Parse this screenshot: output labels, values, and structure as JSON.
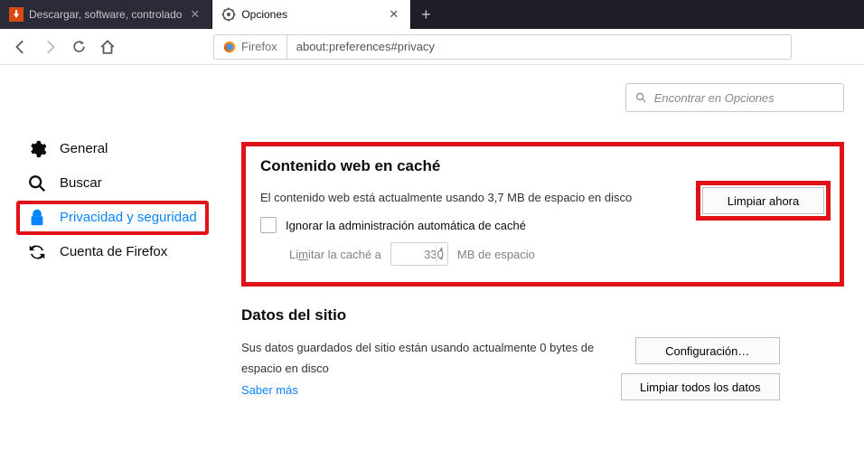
{
  "tabs": [
    {
      "title": "Descargar, software, controlado"
    },
    {
      "title": "Opciones"
    }
  ],
  "urlbar": {
    "identity": "Firefox",
    "address": "about:preferences#privacy"
  },
  "search": {
    "placeholder": "Encontrar en Opciones"
  },
  "sidebar": {
    "items": [
      {
        "label": "General"
      },
      {
        "label": "Buscar"
      },
      {
        "label": "Privacidad y seguridad"
      },
      {
        "label": "Cuenta de Firefox"
      }
    ]
  },
  "cache": {
    "title": "Contenido web en caché",
    "usage_text": "El contenido web está actualmente usando 3,7 MB de espacio en disco",
    "clear_button": "Limpiar ahora",
    "override_label": "Ignorar la administración automática de caché",
    "limit_prefix": "Li",
    "limit_access": "m",
    "limit_suffix": "itar la caché a",
    "limit_value": "330",
    "limit_unit": "MB de espacio"
  },
  "sitedata": {
    "title": "Datos del sitio",
    "usage_text": "Sus datos guardados del sitio están usando actualmente 0 bytes de espacio en disco",
    "learn_more": "Saber más",
    "settings_button": "Configuración…",
    "clear_all_button": "Limpiar todos los datos"
  }
}
